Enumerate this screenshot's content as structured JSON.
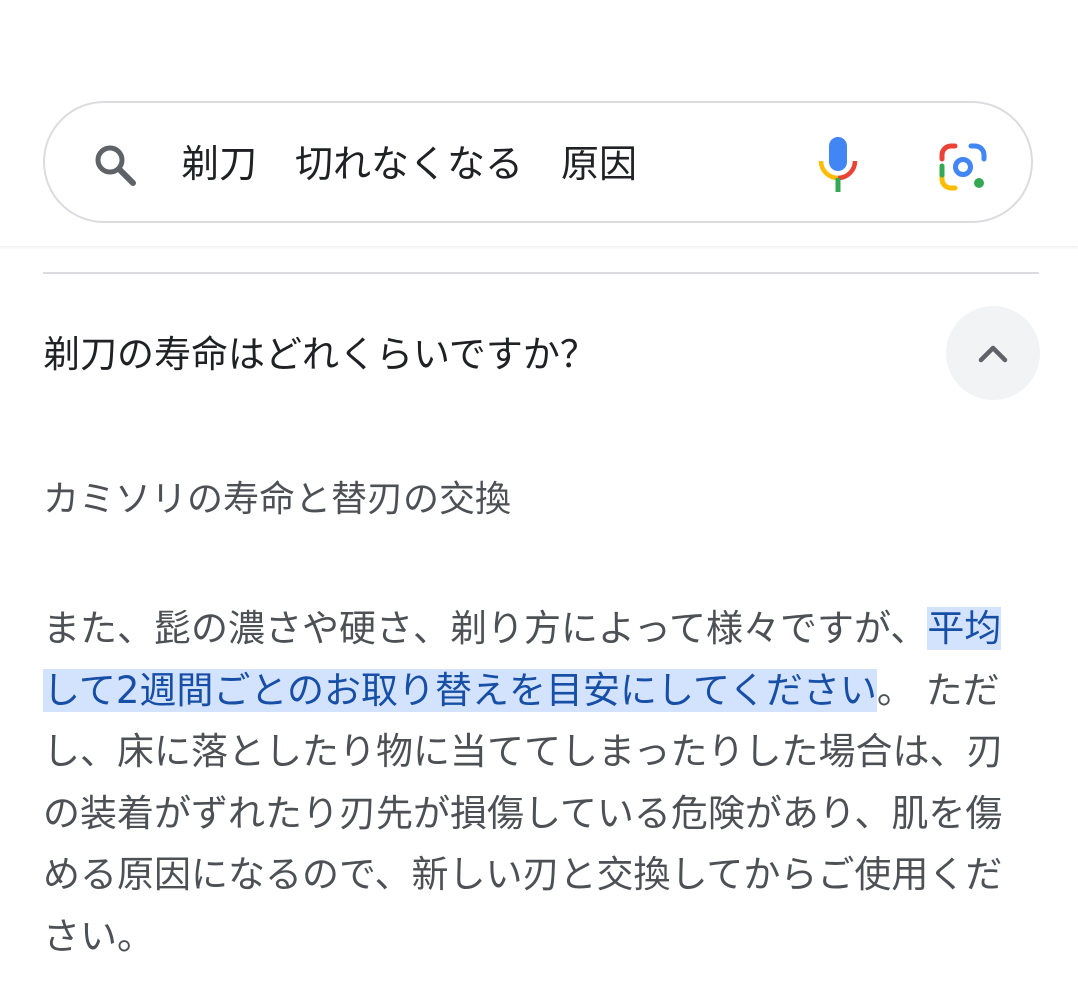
{
  "search": {
    "query": "剃刀　切れなくなる　原因",
    "icons": {
      "search": "search-icon",
      "voice": "mic-icon",
      "lens": "lens-icon"
    }
  },
  "faq": {
    "question": "剃刀の寿命はどれくらいですか？",
    "toggle_icon": "chevron-up-icon",
    "answer_title": "カミソリの寿命と替刃の交換",
    "answer_before": "また、髭の濃さや硬さ、剃り方によって様々ですが、",
    "answer_highlight": "平均して2週間ごとのお取り替えを目安にしてください",
    "answer_after": "。 ただし、床に落としたり物に当ててしまったりした場合は、刃の装着がずれたり刃先が損傷している危険があり、肌を傷める原因になるので、新しい刃と交換してからご使用ください。"
  },
  "colors": {
    "highlight_bg": "#d3e3fd",
    "highlight_text": "#174ea6",
    "google_blue": "#4285f4",
    "google_red": "#ea4335",
    "google_yellow": "#fbbc04",
    "google_green": "#34a853"
  }
}
